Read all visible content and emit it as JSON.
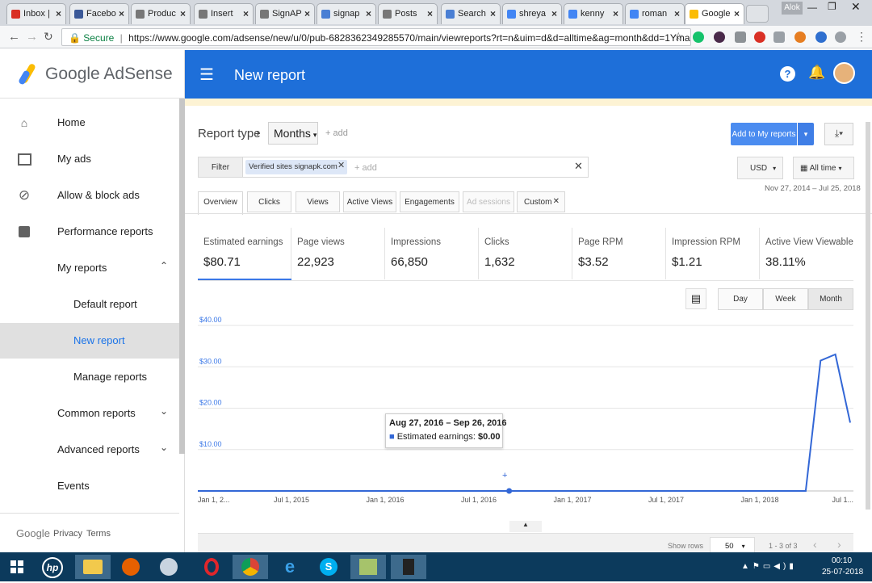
{
  "browser": {
    "tabs": [
      {
        "label": "Inbox |",
        "icon": "gmail-icon",
        "color": "#d93025"
      },
      {
        "label": "Facebo",
        "icon": "facebook-icon",
        "color": "#3b5998"
      },
      {
        "label": "Produc",
        "icon": "product-icon",
        "color": "#777777"
      },
      {
        "label": "Insert",
        "icon": "page-icon",
        "color": "#777777"
      },
      {
        "label": "SignAP",
        "icon": "page-icon",
        "color": "#777777"
      },
      {
        "label": "signap",
        "icon": "signapk-icon",
        "color": "#4a7fd4"
      },
      {
        "label": "Posts",
        "icon": "page-icon",
        "color": "#777777"
      },
      {
        "label": "Search",
        "icon": "search-page-icon",
        "color": "#4a7fd4"
      },
      {
        "label": "shreya",
        "icon": "google-icon",
        "color": "#4285f4"
      },
      {
        "label": "kenny",
        "icon": "google-icon",
        "color": "#4285f4"
      },
      {
        "label": "roman",
        "icon": "google-icon",
        "color": "#4285f4"
      },
      {
        "label": "Google",
        "icon": "adsense-icon",
        "color": "#fbbc04"
      }
    ],
    "user_label": "Alok",
    "secure_label": "Secure",
    "url": "https://www.google.com/adsense/new/u/0/pub-6828362349285570/main/viewreports?rt=n&uim=d&d=alltime&ag=month&dd=1Ymana..."
  },
  "sidebar": {
    "brand": "Google AdSense",
    "items": [
      {
        "label": "Home",
        "icon": "home-icon"
      },
      {
        "label": "My ads",
        "icon": "ads-icon"
      },
      {
        "label": "Allow & block ads",
        "icon": "block-icon"
      },
      {
        "label": "Performance reports",
        "icon": "reports-icon"
      },
      {
        "label": "My reports"
      },
      {
        "label": "Default report"
      },
      {
        "label": "New report"
      },
      {
        "label": "Manage reports"
      },
      {
        "label": "Common reports"
      },
      {
        "label": "Advanced reports"
      },
      {
        "label": "Events"
      }
    ],
    "footer": {
      "google": "Google",
      "privacy": "Privacy",
      "terms": "Terms"
    }
  },
  "header": {
    "title": "New report"
  },
  "report": {
    "report_type_label": "Report type",
    "report_type_value": "Months",
    "add_label": "+ add",
    "add_to_my_reports": "Add to My reports",
    "filter_label": "Filter",
    "filter_chip": "Verified sites signapk.com",
    "currency": "USD",
    "date_range_label": "All time",
    "date_range_text": "Nov 27, 2014 – Jul 25, 2018",
    "tabs": [
      "Overview",
      "Clicks",
      "Views",
      "Active Views",
      "Engagements",
      "Ad sessions",
      "Custom"
    ],
    "metrics": [
      {
        "label": "Estimated earnings",
        "value": "$80.71"
      },
      {
        "label": "Page views",
        "value": "22,923"
      },
      {
        "label": "Impressions",
        "value": "66,850"
      },
      {
        "label": "Clicks",
        "value": "1,632"
      },
      {
        "label": "Page RPM",
        "value": "$3.52"
      },
      {
        "label": "Impression RPM",
        "value": "$1.21"
      },
      {
        "label": "Active View Viewable",
        "value": "38.11%"
      }
    ],
    "granularity": [
      "Day",
      "Week",
      "Month"
    ],
    "tooltip": {
      "range": "Aug 27, 2016 – Sep 26, 2016",
      "label": "Estimated earnings:",
      "value": "$0.00"
    },
    "show_rows_label": "Show rows",
    "show_rows_value": "50",
    "pagination": "1 - 3 of 3"
  },
  "chart_data": {
    "type": "line",
    "title": "",
    "xlabel": "",
    "ylabel": "",
    "ylim": [
      0,
      40
    ],
    "yticks": [
      "$40.00",
      "$30.00",
      "$20.00",
      "$10.00"
    ],
    "xticks": [
      "Jan 1, 2...",
      "Jul 1, 2015",
      "Jan 1, 2016",
      "Jul 1, 2016",
      "Jan 1, 2017",
      "Jul 1, 2017",
      "Jan 1, 2018",
      "Jul 1..."
    ],
    "grid": true,
    "series": [
      {
        "name": "Estimated earnings",
        "color": "#3367d6",
        "x": [
          "2014-11",
          "2015-06",
          "2016-01",
          "2016-08",
          "2017-06",
          "2018-03",
          "2018-04",
          "2018-05",
          "2018-06",
          "2018-07"
        ],
        "y": [
          0,
          0,
          0,
          0,
          0,
          0,
          0,
          31.5,
          33.0,
          16.5
        ]
      }
    ]
  },
  "taskbar": {
    "time": "00:10",
    "date": "25-07-2018"
  }
}
